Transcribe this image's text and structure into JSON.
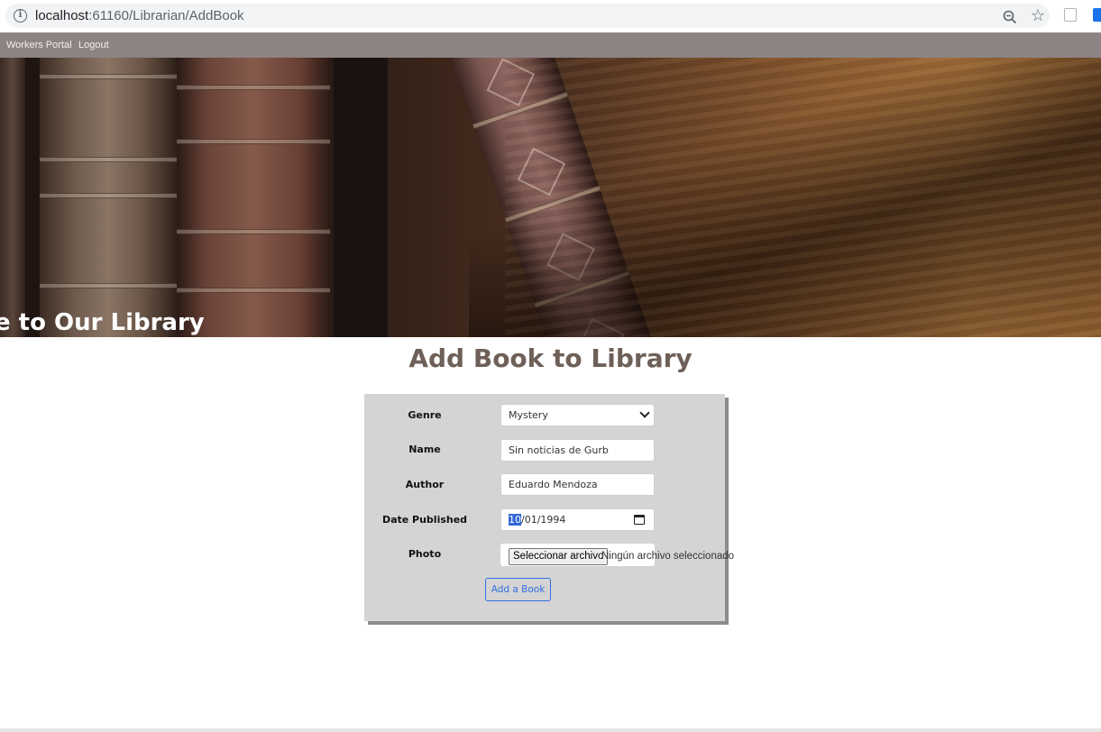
{
  "browser": {
    "url_host": "localhost",
    "url_path": ":61160/Librarian/AddBook",
    "icons": [
      "info-icon",
      "zoom-icon",
      "star-icon",
      "extension-icon",
      "extension-icon"
    ]
  },
  "nav": {
    "links": [
      "Workers Portal",
      "Logout"
    ]
  },
  "hero": {
    "welcome_text": "e to Our Library"
  },
  "page": {
    "title": "Add Book to Library"
  },
  "form": {
    "genre_label": "Genre",
    "genre_value": "Mystery",
    "name_label": "Name",
    "name_value": "Sin noticias de Gurb",
    "author_label": "Author",
    "author_value": "Eduardo Mendoza",
    "date_label": "Date Published",
    "date_month": "10",
    "date_rest": "/01/1994",
    "photo_label": "Photo",
    "file_button_label": "Seleccionar archivo",
    "file_status": "Ningún archivo seleccionado",
    "submit_label": "Add a Book"
  },
  "colors": {
    "nav_background": "#8c8483",
    "title_color": "#6e6058",
    "panel_background": "#d5d3d4",
    "button_accent": "#2f6fe0"
  }
}
